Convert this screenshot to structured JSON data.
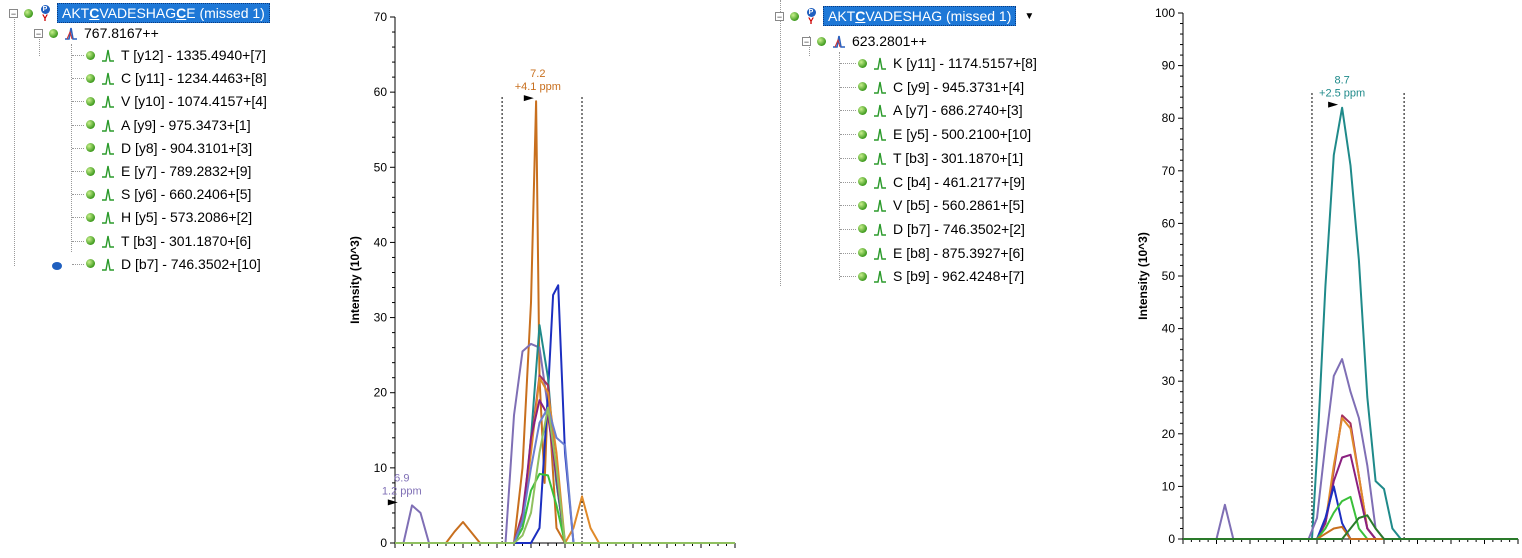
{
  "left_tree": {
    "peptide_prefix": "AKT",
    "peptide_c1": "C",
    "peptide_mid": "VADESHAG",
    "peptide_c2": "C",
    "peptide_suffix": "E (missed 1)",
    "precursor": "767.8167++",
    "fragments": [
      "T [y12] - 1335.4940+[7]",
      "C [y11] - 1234.4463+[8]",
      "V [y10] - 1074.4157+[4]",
      "A [y9] - 975.3473+[1]",
      "D [y8] - 904.3101+[3]",
      "E [y7] - 789.2832+[9]",
      "S [y6] - 660.2406+[5]",
      "H [y5] - 573.2086+[2]",
      "T [b3] - 301.1870+[6]",
      "D [b7] - 746.3502+[10]"
    ]
  },
  "right_tree": {
    "peptide_prefix": "AKT",
    "peptide_c1": "C",
    "peptide_suffix": "VADESHAG (missed 1)",
    "precursor": "623.2801++",
    "fragments": [
      "K [y11] - 1174.5157+[8]",
      "C [y9] - 945.3731+[4]",
      "A [y7] - 686.2740+[3]",
      "E [y5] - 500.2100+[10]",
      "T [b3] - 301.1870+[1]",
      "C [b4] - 461.2177+[9]",
      "V [b5] - 560.2861+[5]",
      "D [b7] - 746.3502+[2]",
      "E [b8] - 875.3927+[6]",
      "S [b9] - 962.4248+[7]"
    ]
  },
  "colors": {
    "selection": "#1e78d7",
    "node_green": "#3e9a1e",
    "fragment_icon": "#2a9a2a"
  },
  "chart_data": [
    {
      "type": "line",
      "ylabel": "Intensity (10^3)",
      "ylim": [
        0,
        70
      ],
      "yticks": [
        "0",
        "10",
        "20",
        "30",
        "40",
        "50",
        "60",
        "70"
      ],
      "xlim": [
        0,
        20
      ],
      "peak_boundaries": [
        6.3,
        11.0
      ],
      "annotations": [
        {
          "rt": "7.2",
          "ppm": "+4.1 ppm",
          "x": 8.4,
          "y": 58.8,
          "color": "#c86f1e"
        },
        {
          "rt": "6.9",
          "ppm": "1.2 ppm",
          "x": 0.4,
          "y": 5.0,
          "color": "#7f6fb5"
        }
      ],
      "series": [
        {
          "color": "#c86f1e",
          "x": [
            0,
            1,
            2,
            3,
            3.5,
            4,
            5,
            6,
            6.5,
            7,
            7.5,
            8,
            8.3,
            8.5,
            8.8,
            9,
            9.5,
            10,
            11,
            12,
            20
          ],
          "y": [
            0,
            0,
            0,
            0,
            1.5,
            2.8,
            0,
            0,
            0,
            0,
            10,
            32,
            58.8,
            22,
            8,
            20,
            2,
            0,
            0,
            0,
            0
          ]
        },
        {
          "color": "#7f6fb5",
          "x": [
            0,
            0.5,
            1,
            1.5,
            2,
            3,
            6,
            6.5,
            7,
            7.5,
            8,
            8.5,
            9,
            9.5,
            10,
            11,
            20
          ],
          "y": [
            0,
            0,
            5,
            4,
            0,
            0,
            0,
            0,
            17,
            25.5,
            26.5,
            26,
            18,
            8,
            0,
            0,
            0
          ]
        },
        {
          "color": "#1c2fc0",
          "x": [
            0,
            7,
            7.5,
            8,
            8.5,
            9,
            9.3,
            9.6,
            10,
            10.5,
            20
          ],
          "y": [
            0,
            0,
            0,
            0,
            2,
            20,
            33,
            34.3,
            12,
            0,
            0
          ]
        },
        {
          "color": "#1f8a8a",
          "x": [
            0,
            7,
            7.5,
            8,
            8.5,
            9,
            9.5,
            10,
            20
          ],
          "y": [
            0,
            0,
            2,
            14,
            29,
            22,
            8,
            0,
            0
          ]
        },
        {
          "color": "#a33060",
          "x": [
            0,
            7,
            7.5,
            8,
            8.5,
            9,
            9.5,
            10,
            20
          ],
          "y": [
            0,
            0,
            4,
            13,
            22.3,
            21,
            9,
            0,
            0
          ]
        },
        {
          "color": "#e08a2a",
          "x": [
            0,
            7,
            7.5,
            8,
            8.5,
            9,
            9.5,
            10,
            10.5,
            11,
            11.5,
            12,
            20
          ],
          "y": [
            0,
            0,
            3,
            12,
            22,
            20,
            12,
            0,
            2,
            6.2,
            2,
            0,
            0
          ]
        },
        {
          "color": "#8a2080",
          "x": [
            0,
            7,
            7.5,
            8,
            8.5,
            9,
            9.5,
            10,
            20
          ],
          "y": [
            0,
            0,
            3,
            14,
            19,
            17,
            9,
            0,
            0
          ]
        },
        {
          "color": "#3ac03a",
          "x": [
            0,
            7,
            7.5,
            8,
            8.5,
            9,
            9.5,
            10,
            20
          ],
          "y": [
            0,
            0,
            2,
            7,
            9.2,
            9,
            5,
            0,
            0
          ]
        },
        {
          "color": "#6a7fd0",
          "x": [
            0,
            7,
            7.5,
            8,
            8.5,
            9,
            9.5,
            10,
            10.5,
            20
          ],
          "y": [
            0,
            0,
            3,
            10,
            16,
            18,
            14,
            13,
            0,
            0
          ]
        },
        {
          "color": "#90c060",
          "x": [
            0,
            7,
            7.5,
            8,
            8.5,
            9,
            9.5,
            10,
            20
          ],
          "y": [
            0,
            0,
            1,
            4,
            12,
            18,
            10,
            0,
            0
          ]
        }
      ]
    },
    {
      "type": "line",
      "ylabel": "Intensity (10^3)",
      "ylim": [
        0,
        100
      ],
      "yticks": [
        "0",
        "10",
        "20",
        "30",
        "40",
        "50",
        "60",
        "70",
        "80",
        "90",
        "100"
      ],
      "xlim": [
        0,
        20
      ],
      "peak_boundaries": [
        7.7,
        13.2
      ],
      "annotations": [
        {
          "rt": "8.7",
          "ppm": "+2.5 ppm",
          "x": 9.5,
          "y": 82,
          "color": "#1f8a8a"
        }
      ],
      "series": [
        {
          "color": "#1f8a8a",
          "x": [
            0,
            7,
            7.7,
            8,
            8.5,
            9,
            9.5,
            10,
            10.5,
            11,
            11.5,
            12,
            12.5,
            13,
            20
          ],
          "y": [
            0,
            0,
            0,
            16,
            48,
            73,
            82,
            71,
            53,
            27,
            11,
            9.5,
            2,
            0,
            0
          ]
        },
        {
          "color": "#7f6fb5",
          "x": [
            0,
            2,
            2.5,
            3,
            7.5,
            8,
            8.5,
            9,
            9.5,
            10,
            10.5,
            11,
            11.5,
            12,
            20
          ],
          "y": [
            0,
            0,
            6.5,
            0,
            0,
            4,
            18,
            31,
            34.2,
            28,
            23,
            14,
            2,
            0,
            0
          ]
        },
        {
          "color": "#a33060",
          "x": [
            0,
            8,
            8.5,
            9,
            9.5,
            10,
            10.5,
            11,
            11.5,
            20
          ],
          "y": [
            0,
            0,
            3,
            13,
            23.5,
            22,
            12,
            2,
            0,
            0
          ]
        },
        {
          "color": "#e08a2a",
          "x": [
            0,
            8,
            8.5,
            9,
            9.5,
            10,
            10.5,
            11,
            11.5,
            20
          ],
          "y": [
            0,
            0,
            3,
            14,
            23,
            21,
            12,
            2,
            0,
            0
          ]
        },
        {
          "color": "#8a2080",
          "x": [
            0,
            8,
            8.5,
            9,
            9.5,
            10,
            10.5,
            11,
            11.5,
            20
          ],
          "y": [
            0,
            0,
            3,
            11,
            15.5,
            16,
            9,
            2,
            0,
            0
          ]
        },
        {
          "color": "#1c2fc0",
          "x": [
            0,
            8,
            8.5,
            9,
            9.5,
            10,
            20
          ],
          "y": [
            0,
            0,
            4,
            10,
            3,
            0,
            0
          ]
        },
        {
          "color": "#3ac03a",
          "x": [
            0,
            8,
            8.5,
            9,
            9.5,
            10,
            10.5,
            11,
            20
          ],
          "y": [
            0,
            0,
            2,
            5,
            7.2,
            8,
            2,
            0,
            0
          ]
        },
        {
          "color": "#c86f1e",
          "x": [
            0,
            8,
            8.5,
            9,
            9.5,
            10,
            20
          ],
          "y": [
            0,
            0,
            1,
            2,
            2.3,
            0,
            0
          ]
        },
        {
          "color": "#2a7a2a",
          "x": [
            0,
            9.5,
            10,
            10.5,
            11,
            11.5,
            12,
            20
          ],
          "y": [
            0,
            0,
            2,
            4,
            4.5,
            2,
            0,
            0
          ]
        }
      ]
    }
  ]
}
